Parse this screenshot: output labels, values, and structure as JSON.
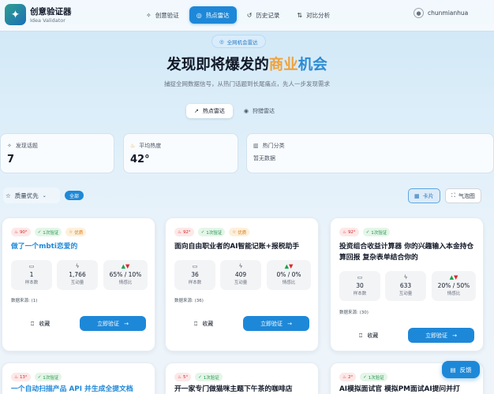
{
  "app": {
    "title": "创意验证器",
    "subtitle": "Idea Validator",
    "logo_icon": "sparkle-icon"
  },
  "nav": {
    "items": [
      {
        "label": "创意验证",
        "icon": "sparkle-icon",
        "active": false
      },
      {
        "label": "热点雷达",
        "icon": "radar-icon",
        "active": true
      },
      {
        "label": "历史记录",
        "icon": "history-icon",
        "active": false
      },
      {
        "label": "对比分析",
        "icon": "compare-icon",
        "active": false
      }
    ],
    "username": "chunmianhua"
  },
  "hero": {
    "pill": "全网机会雷达",
    "title_prefix": "发现即将爆发的",
    "title_accent1": "商业",
    "title_accent2": "机会",
    "subtitle": "捕捉全网数据信号，从热门话题到长尾痛点，先人一步发现需求"
  },
  "modes": [
    {
      "label": "热点雷达",
      "active": true
    },
    {
      "label": "狩猎雷达",
      "active": false
    }
  ],
  "stats": [
    {
      "label": "发现话题",
      "value": "7"
    },
    {
      "label": "平均热度",
      "value": "42°"
    },
    {
      "label": "热门分类",
      "value": "暂无数据"
    }
  ],
  "toolbar": {
    "sort_label": "质量优先",
    "all_badge": "全部",
    "view_card": "卡片",
    "view_bubble": "气泡图"
  },
  "cards": [
    {
      "score": "90°",
      "verify": "1次验证",
      "good": "优质",
      "title": "做了一个mbti恋爱的",
      "samples": "1",
      "samples_label": "样本数",
      "interactions": "1,766",
      "interactions_label": "互动量",
      "sentiment": "65% / 10%",
      "sentiment_label": "情感比",
      "source": "数据来源:  (1)",
      "fav": "收藏",
      "go": "立即验证"
    },
    {
      "score": "92°",
      "verify": "1次验证",
      "good": "优质",
      "title": "面向自由职业者的AI智能记账+报税助手",
      "samples": "36",
      "samples_label": "样本数",
      "interactions": "409",
      "interactions_label": "互动量",
      "sentiment": "0% / 0%",
      "sentiment_label": "情感比",
      "source": "数据来源:  (36)",
      "fav": "收藏",
      "go": "立即验证"
    },
    {
      "score": "92°",
      "verify": "1次验证",
      "title": "投资组合收益计算器 你的兴趣输入本金持仓算回报 复杂表单结合你的",
      "samples": "30",
      "samples_label": "样本数",
      "interactions": "633",
      "interactions_label": "互动量",
      "sentiment": "20% / 50%",
      "sentiment_label": "情感比",
      "source": "数据来源:  (30)",
      "fav": "收藏",
      "go": "立即验证"
    },
    {
      "score": "13°",
      "verify": "1次验证",
      "title": "一个自动扫描产品 API 并生成全提文档"
    },
    {
      "score": "5°",
      "verify": "1次验证",
      "title": "开一家专门做猫咪主题下午茶的咖啡店"
    },
    {
      "score": "2°",
      "verify": "1次验证",
      "title": "AI模拟面试官 模拟PM面试AI提问并打"
    }
  ],
  "feedback": "反馈",
  "colors": {
    "accent": "#1e88d8",
    "title_accent": "#f0a23b"
  }
}
